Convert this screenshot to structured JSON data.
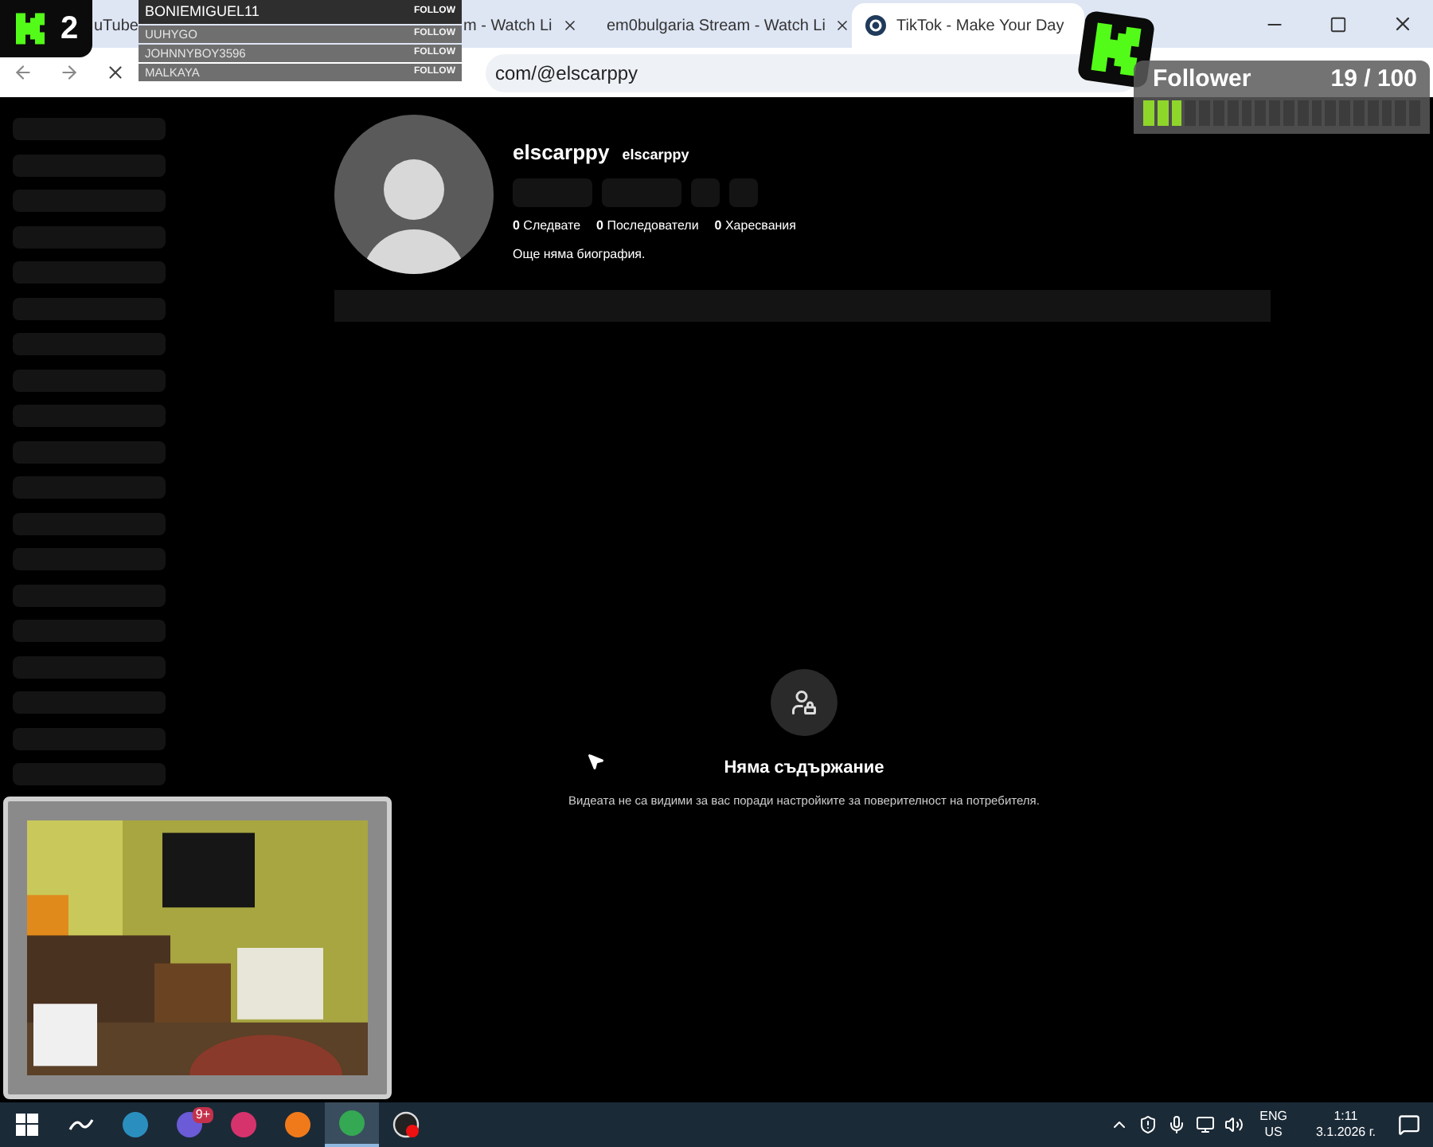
{
  "browser": {
    "tabs": [
      {
        "title": "uTube",
        "kind": "plain",
        "selected": false
      },
      {
        "title": "m - Watch Li",
        "kind": "partial",
        "selected": false
      },
      {
        "title": "em0bulgaria Stream - Watch Li",
        "kind": "kick",
        "selected": false
      },
      {
        "title": "TikTok - Make Your Day",
        "kind": "tiktok",
        "selected": true
      }
    ],
    "url": "com/@elscarppy"
  },
  "profile": {
    "name": "elscarppy",
    "handle": "elscarppy",
    "stats": [
      "**0** Следвате",
      "**0** Последователи",
      "**0** Харесвания"
    ],
    "bio": "Още няма биография."
  },
  "empty_state": {
    "title": "Няма съдържание",
    "message": "Видеата не са видими за вас поради настройките за поверителност на потребителя."
  },
  "overlay_k2": {
    "number": "2"
  },
  "recent_follows": [
    {
      "name": "BONIEMIGUEL11",
      "action": "FOLLOW",
      "selected": true
    },
    {
      "name": "UUHYGO",
      "action": "FOLLOW",
      "selected": false
    },
    {
      "name": "JOHNNYBOY3596",
      "action": "FOLLOW",
      "selected": false
    },
    {
      "name": "MALKAYA",
      "action": "FOLLOW",
      "selected": false
    }
  ],
  "follower_goal": {
    "label": "Follower",
    "count": "19 / 100",
    "level": 0.15
  },
  "taskbar": {
    "apps": [
      {
        "kind": "start",
        "selected": false
      },
      {
        "kind": "search",
        "selected": false
      },
      {
        "kind": "app",
        "color": "#2a8fbf",
        "selected": false
      },
      {
        "kind": "app",
        "color": "#6b5bd6",
        "badge": "9+",
        "selected": false
      },
      {
        "kind": "app",
        "color": "#d6336c",
        "selected": false
      },
      {
        "kind": "app",
        "color": "#f07a1a",
        "selected": false
      },
      {
        "kind": "app",
        "color": "#34a853",
        "selected": true
      },
      {
        "kind": "obs",
        "selected": false
      }
    ],
    "language": "ENG",
    "region": "US",
    "time": "1:11",
    "date": "3.1.2026 г."
  }
}
